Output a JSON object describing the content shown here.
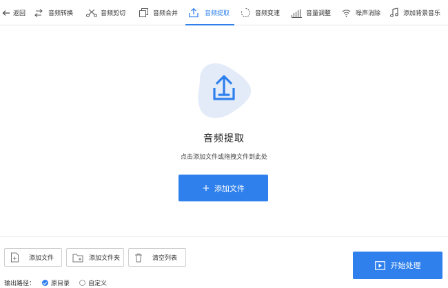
{
  "toolbar": {
    "back_label": "返回",
    "tabs": [
      {
        "label": "音频转换",
        "icon": "convert-icon"
      },
      {
        "label": "音频剪切",
        "icon": "scissors-icon"
      },
      {
        "label": "音频合并",
        "icon": "merge-icon"
      },
      {
        "label": "音频提取",
        "icon": "extract-icon",
        "active": true
      },
      {
        "label": "音频变速",
        "icon": "speed-icon"
      },
      {
        "label": "音量调整",
        "icon": "volume-bars-icon"
      },
      {
        "label": "噪声消除",
        "icon": "noise-icon"
      },
      {
        "label": "添加背景音乐",
        "icon": "music-note-icon"
      }
    ]
  },
  "main": {
    "title": "音频提取",
    "hint": "点击添加文件或拖拽文件到此处",
    "add_file_button": "添加文件"
  },
  "bottom": {
    "add_file": "添加文件",
    "add_folder": "添加文件夹",
    "clear_list": "清空列表",
    "start": "开始处理",
    "output_label": "输出路径：",
    "option_original": "原目录",
    "option_custom": "自定义"
  },
  "colors": {
    "accent": "#2f80ed",
    "blob": "#e3eaf8"
  }
}
